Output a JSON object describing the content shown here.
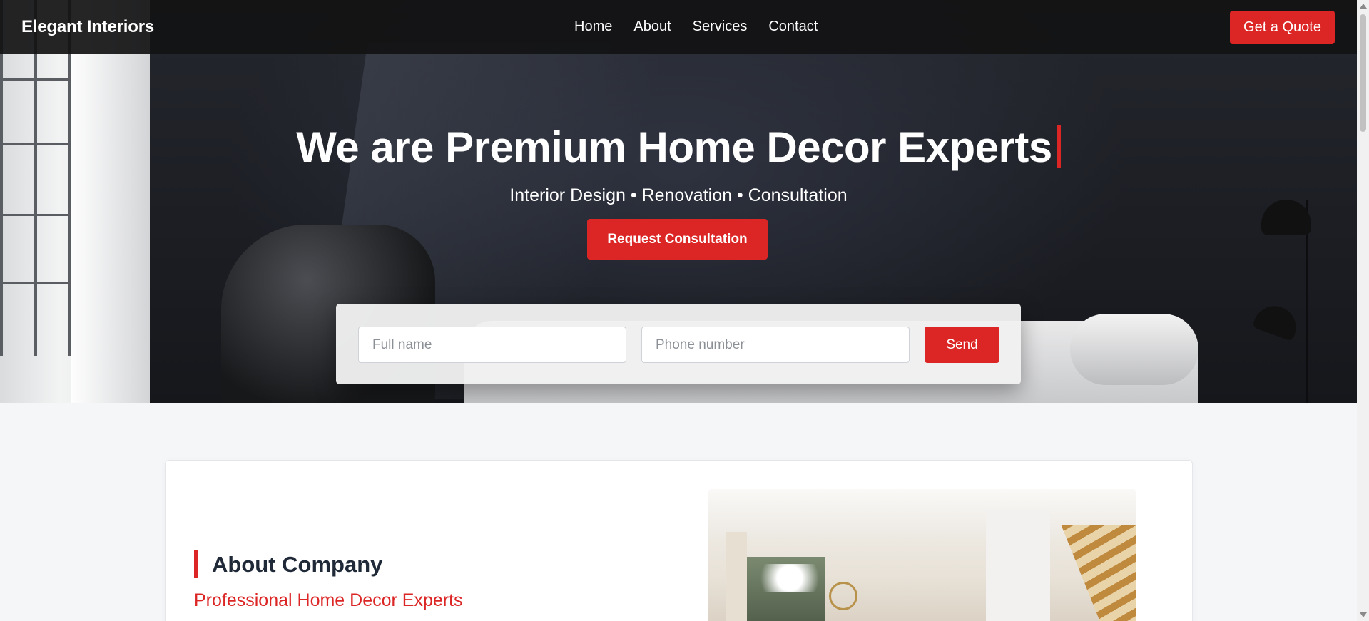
{
  "navbar": {
    "logo": "Elegant Interiors",
    "links": [
      "Home",
      "About",
      "Services",
      "Contact"
    ],
    "cta_label": "Get a Quote"
  },
  "hero": {
    "title": "We are Premium Home Decor Experts",
    "subtitle": "Interior Design • Renovation • Consultation",
    "cta_label": "Request Consultation"
  },
  "form": {
    "name_placeholder": "Full name",
    "phone_placeholder": "Phone number",
    "send_label": "Send"
  },
  "about": {
    "heading": "About Company",
    "subheading": "Professional Home Decor Experts"
  },
  "colors": {
    "accent": "#dc2626",
    "nav_bg": "#121214",
    "heading_text": "#1f2937"
  },
  "icons": {
    "scroll_up": "scroll-up-arrow",
    "scroll_down": "scroll-down-arrow"
  }
}
